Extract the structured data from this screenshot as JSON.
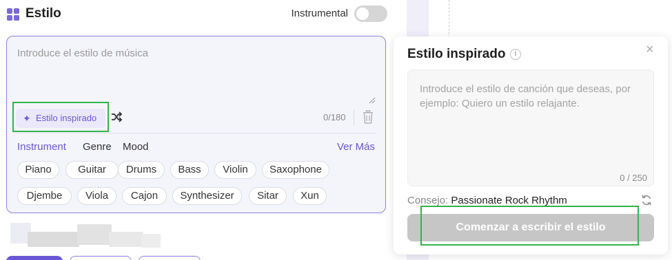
{
  "header": {
    "title": "Estilo",
    "instrumental_label": "Instrumental",
    "instrumental_on": false
  },
  "style_input": {
    "placeholder": "Introduce el estilo de música",
    "counter": "0/180",
    "inspired_button": "Estilo inspirado"
  },
  "tabs": [
    {
      "label": "Instrument",
      "active": true
    },
    {
      "label": "Genre",
      "active": false
    },
    {
      "label": "Mood",
      "active": false
    }
  ],
  "see_more": "Ver Más",
  "chips": [
    "Piano",
    "Guitar",
    "Drums",
    "Bass",
    "Violin",
    "Saxophone",
    "Djembe",
    "Viola",
    "Cajon",
    "Synthesizer",
    "Sitar",
    "Xun"
  ],
  "popover": {
    "title": "Estilo inspirado",
    "info_glyph": "i",
    "close_glyph": "×",
    "placeholder": "Introduce el estilo de canción que deseas, por ejemplo: Quiero un estilo relajante.",
    "counter": "0 / 250",
    "tip_label": "Consejo:",
    "tip_value": "Passionate Rock Rhythm",
    "start_button": "Comenzar a escribir el estilo"
  },
  "colors": {
    "accent": "#6a57d6",
    "highlight": "#32b34a",
    "disabled_button": "#c6c6c6"
  }
}
